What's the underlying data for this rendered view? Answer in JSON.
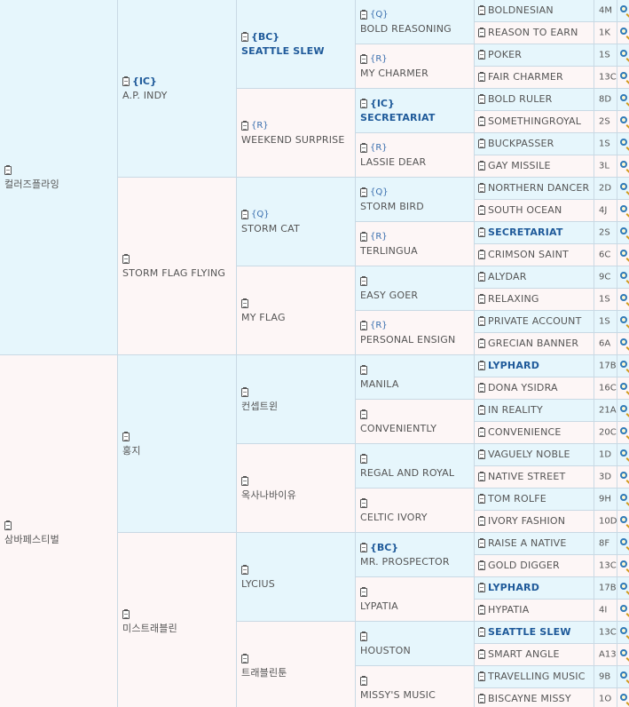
{
  "pedigree": {
    "gen1": [
      {
        "name": "컬러즈플라잉",
        "tag": ""
      },
      {
        "name": "삼바페스티벌",
        "tag": ""
      }
    ],
    "gen2": [
      {
        "name": "A.P. INDY",
        "tag": "{IC}",
        "tag_bold": true,
        "name_bold": false
      },
      {
        "name": "STORM FLAG FLYING",
        "tag": ""
      },
      {
        "name": "홍지",
        "tag": ""
      },
      {
        "name": "미스트래블린",
        "tag": ""
      }
    ],
    "gen3": [
      {
        "name": "SEATTLE SLEW",
        "tag": "{BC}",
        "tag_bold": true,
        "name_bold": true
      },
      {
        "name": "WEEKEND SURPRISE",
        "tag": "{R}"
      },
      {
        "name": "STORM CAT",
        "tag": "{Q}"
      },
      {
        "name": "MY FLAG",
        "tag": ""
      },
      {
        "name": "컨셉트윈",
        "tag": ""
      },
      {
        "name": "옥사나바이유",
        "tag": ""
      },
      {
        "name": "LYCIUS",
        "tag": ""
      },
      {
        "name": "트래블린툰",
        "tag": ""
      }
    ],
    "gen4": [
      {
        "name": "BOLD REASONING",
        "tag": "{Q}"
      },
      {
        "name": "MY CHARMER",
        "tag": "{R}"
      },
      {
        "name": "SECRETARIAT",
        "tag": "{IC}",
        "tag_bold": true,
        "name_bold": true
      },
      {
        "name": "LASSIE DEAR",
        "tag": "{R}"
      },
      {
        "name": "STORM BIRD",
        "tag": "{Q}"
      },
      {
        "name": "TERLINGUA",
        "tag": "{R}"
      },
      {
        "name": "EASY GOER",
        "tag": ""
      },
      {
        "name": "PERSONAL ENSIGN",
        "tag": "{R}"
      },
      {
        "name": "MANILA",
        "tag": ""
      },
      {
        "name": "CONVENIENTLY",
        "tag": ""
      },
      {
        "name": "REGAL AND ROYAL",
        "tag": ""
      },
      {
        "name": "CELTIC IVORY",
        "tag": ""
      },
      {
        "name": "MR. PROSPECTOR",
        "tag": "{BC}",
        "tag_bold": true
      },
      {
        "name": "LYPATIA",
        "tag": ""
      },
      {
        "name": "HOUSTON",
        "tag": ""
      },
      {
        "name": "MISSY'S MUSIC",
        "tag": ""
      }
    ],
    "gen5": [
      {
        "name": "BOLDNESIAN",
        "code": "4M"
      },
      {
        "name": "REASON TO EARN",
        "code": "1K"
      },
      {
        "name": "POKER",
        "code": "1S"
      },
      {
        "name": "FAIR CHARMER",
        "code": "13C"
      },
      {
        "name": "BOLD RULER",
        "code": "8D"
      },
      {
        "name": "SOMETHINGROYAL",
        "code": "2S"
      },
      {
        "name": "BUCKPASSER",
        "code": "1S"
      },
      {
        "name": "GAY MISSILE",
        "code": "3L"
      },
      {
        "name": "NORTHERN DANCER",
        "code": "2D"
      },
      {
        "name": "SOUTH OCEAN",
        "code": "4J"
      },
      {
        "name": "SECRETARIAT",
        "code": "2S",
        "bold": true
      },
      {
        "name": "CRIMSON SAINT",
        "code": "6C"
      },
      {
        "name": "ALYDAR",
        "code": "9C"
      },
      {
        "name": "RELAXING",
        "code": "1S"
      },
      {
        "name": "PRIVATE ACCOUNT",
        "code": "1S"
      },
      {
        "name": "GRECIAN BANNER",
        "code": "6A"
      },
      {
        "name": "LYPHARD",
        "code": "17B",
        "bold": true
      },
      {
        "name": "DONA YSIDRA",
        "code": "16C"
      },
      {
        "name": "IN REALITY",
        "code": "21A"
      },
      {
        "name": "CONVENIENCE",
        "code": "20C"
      },
      {
        "name": "VAGUELY NOBLE",
        "code": "1D"
      },
      {
        "name": "NATIVE STREET",
        "code": "3D"
      },
      {
        "name": "TOM ROLFE",
        "code": "9H"
      },
      {
        "name": "IVORY FASHION",
        "code": "10D"
      },
      {
        "name": "RAISE A NATIVE",
        "code": "8F"
      },
      {
        "name": "GOLD DIGGER",
        "code": "13C"
      },
      {
        "name": "LYPHARD",
        "code": "17B",
        "bold": true
      },
      {
        "name": "HYPATIA",
        "code": "4I"
      },
      {
        "name": "SEATTLE SLEW",
        "code": "13C",
        "bold": true
      },
      {
        "name": "SMART ANGLE",
        "code": "A13"
      },
      {
        "name": "TRAVELLING MUSIC",
        "code": "9B"
      },
      {
        "name": "BISCAYNE MISSY",
        "code": "1O"
      }
    ]
  },
  "icons": {
    "note": "clipboard-icon",
    "search": "magnifier-icon"
  },
  "colors": {
    "male_bg": "#e6f6fc",
    "female_bg": "#fdf6f6",
    "tag": "#3a6fae",
    "highlight": "#1f5a9a",
    "border": "#c9d9e4"
  }
}
